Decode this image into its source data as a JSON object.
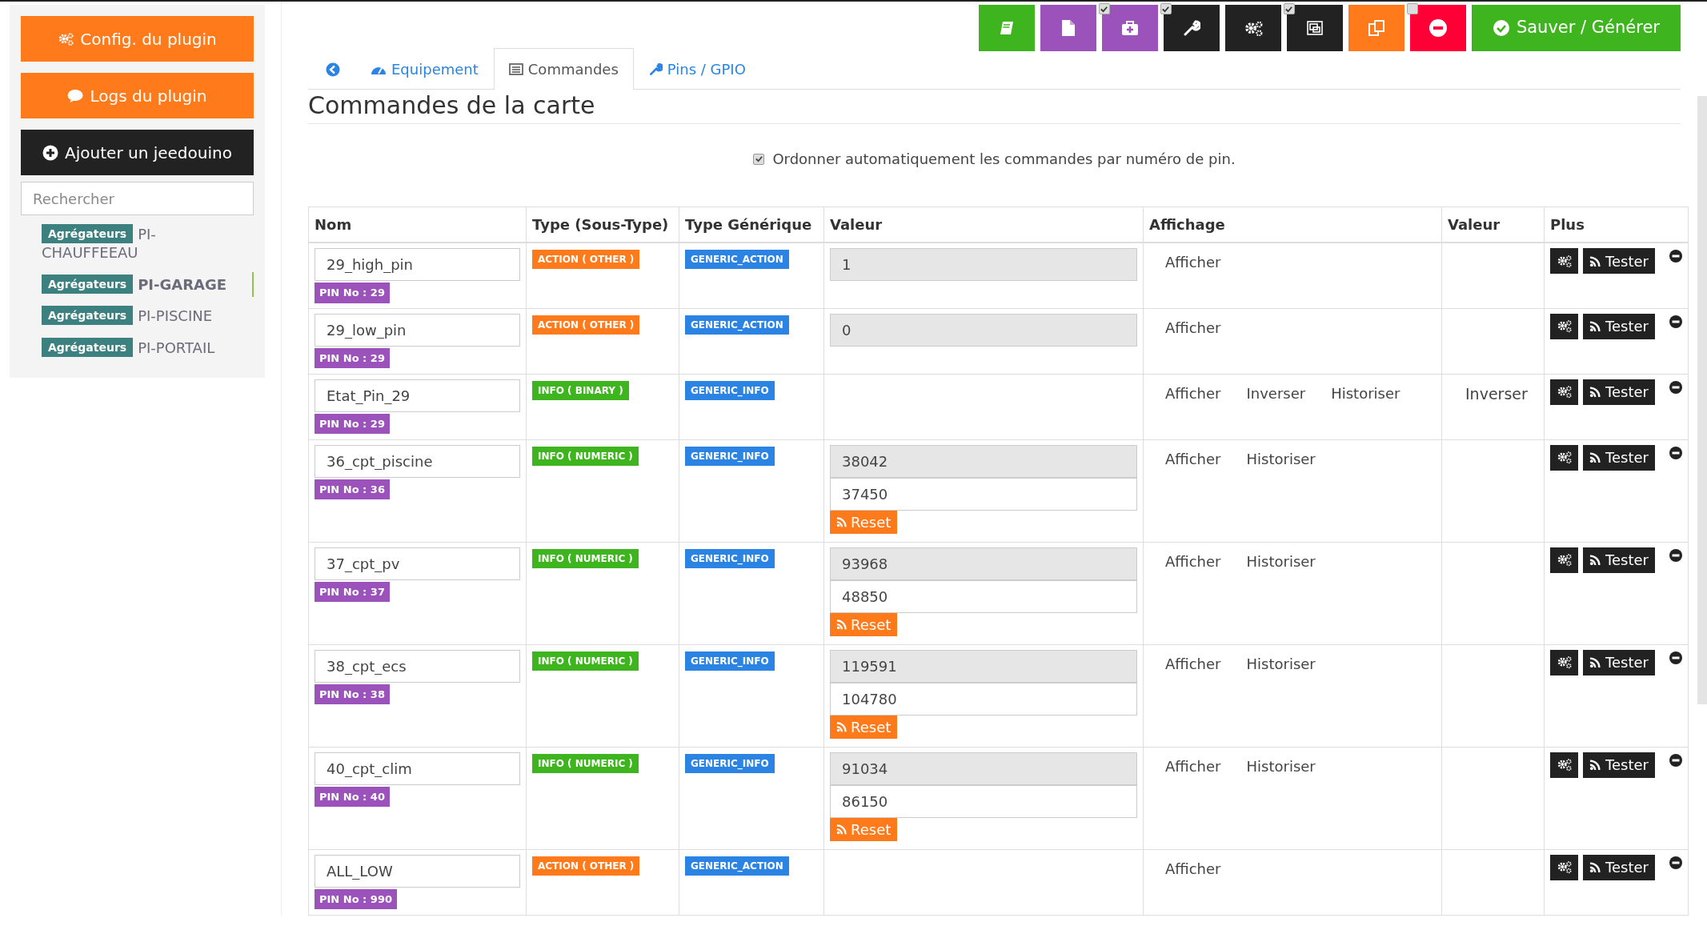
{
  "sidebar": {
    "buttons": [
      {
        "label": "Config. du plugin"
      },
      {
        "label": "Logs du plugin"
      },
      {
        "label": "Ajouter un jeedouino"
      }
    ],
    "search": {
      "placeholder": "Rechercher"
    },
    "items": [
      {
        "tag": "Agrégateurs",
        "name": "PI-CHAUFFEEAU",
        "selected": false
      },
      {
        "tag": "Agrégateurs",
        "name": "PI-GARAGE",
        "selected": true
      },
      {
        "tag": "Agrégateurs",
        "name": "PI-PISCINE",
        "selected": false
      },
      {
        "tag": "Agrégateurs",
        "name": "PI-PORTAIL",
        "selected": false
      }
    ]
  },
  "toolbar": {
    "checkboxes": [
      {
        "checked": true
      },
      {
        "checked": true
      },
      {
        "checked": true
      },
      {
        "checked": false
      }
    ],
    "save": {
      "label": "Sauver / Générer"
    }
  },
  "tabs": [
    {
      "selected": false
    },
    {
      "label": "Equipement",
      "selected": false
    },
    {
      "label": "Commandes",
      "selected": true
    },
    {
      "label": "Pins / GPIO",
      "selected": false
    }
  ],
  "title": "Commandes de la carte",
  "auto_order": {
    "label": "Ordonner automatiquement les commandes par numéro de pin.",
    "checked": true
  },
  "table": {
    "columns": [
      "Nom",
      "Type (Sous-Type)",
      "Type Générique",
      "Valeur",
      "Affichage",
      "Valeur",
      "Plus"
    ],
    "rows": [
      {
        "name": "29_high_pin",
        "pin": "PIN No : 29",
        "type": {
          "label": "ACTION ( OTHER )",
          "kind": "action"
        },
        "generic": "GENERIC_ACTION",
        "value": "1",
        "display": [
          "Afficher"
        ],
        "test": "Tester"
      },
      {
        "name": "29_low_pin",
        "pin": "PIN No : 29",
        "type": {
          "label": "ACTION ( OTHER )",
          "kind": "action"
        },
        "generic": "GENERIC_ACTION",
        "value": "0",
        "display": [
          "Afficher"
        ],
        "test": "Tester"
      },
      {
        "name": "Etat_Pin_29",
        "pin": "PIN No : 29",
        "type": {
          "label": "INFO ( BINARY )",
          "kind": "info"
        },
        "generic": "GENERIC_INFO",
        "display": [
          "Afficher",
          "Inverser",
          "Historiser"
        ],
        "value_option": "Inverser",
        "test": "Tester"
      },
      {
        "name": "36_cpt_piscine",
        "pin": "PIN No : 36",
        "type": {
          "label": "INFO ( NUMERIC )",
          "kind": "info"
        },
        "generic": "GENERIC_INFO",
        "value": "38042",
        "counter": "37450",
        "reset": "Reset",
        "display": [
          "Afficher",
          "Historiser"
        ],
        "test": "Tester"
      },
      {
        "name": "37_cpt_pv",
        "pin": "PIN No : 37",
        "type": {
          "label": "INFO ( NUMERIC )",
          "kind": "info"
        },
        "generic": "GENERIC_INFO",
        "value": "93968",
        "counter": "48850",
        "reset": "Reset",
        "display": [
          "Afficher",
          "Historiser"
        ],
        "test": "Tester"
      },
      {
        "name": "38_cpt_ecs",
        "pin": "PIN No : 38",
        "type": {
          "label": "INFO ( NUMERIC )",
          "kind": "info"
        },
        "generic": "GENERIC_INFO",
        "value": "119591",
        "counter": "104780",
        "reset": "Reset",
        "display": [
          "Afficher",
          "Historiser"
        ],
        "test": "Tester"
      },
      {
        "name": "40_cpt_clim",
        "pin": "PIN No : 40",
        "type": {
          "label": "INFO ( NUMERIC )",
          "kind": "info"
        },
        "generic": "GENERIC_INFO",
        "value": "91034",
        "counter": "86150",
        "reset": "Reset",
        "display": [
          "Afficher",
          "Historiser"
        ],
        "test": "Tester"
      },
      {
        "name": "ALL_LOW",
        "pin": "PIN No : 990",
        "type": {
          "label": "ACTION ( OTHER )",
          "kind": "action"
        },
        "generic": "GENERIC_ACTION",
        "display": [
          "Afficher"
        ],
        "test": "Tester"
      }
    ]
  }
}
